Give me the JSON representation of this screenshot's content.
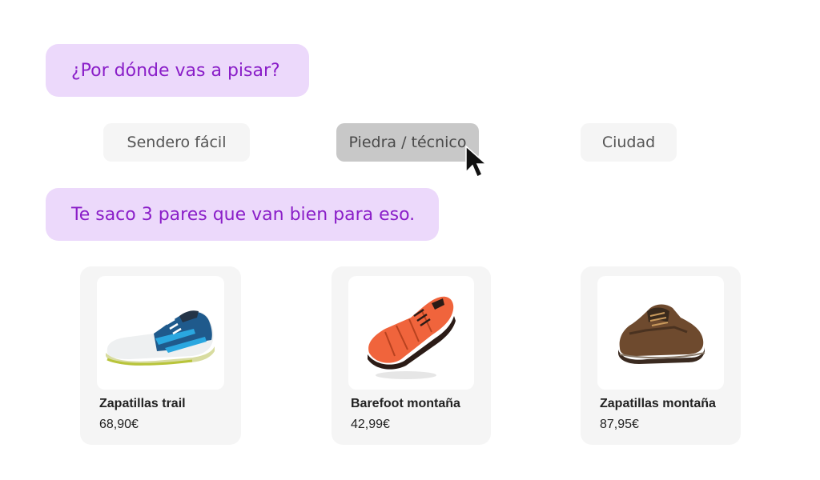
{
  "chat": {
    "question": "¿Por dónde vas a pisar?",
    "answer": "Te saco 3 pares que van bien para eso."
  },
  "options": [
    {
      "label": "Sendero fácil",
      "selected": false
    },
    {
      "label": "Piedra / técnico",
      "selected": true
    },
    {
      "label": "Ciudad",
      "selected": false
    }
  ],
  "products": [
    {
      "name": "Zapatillas trail",
      "price": "68,90€",
      "image": "trail-running-shoe-icon"
    },
    {
      "name": "Barefoot montaña",
      "price": "42,99€",
      "image": "barefoot-shoe-icon"
    },
    {
      "name": "Zapatillas montaña",
      "price": "87,95€",
      "image": "hiking-shoe-icon"
    }
  ],
  "colors": {
    "bubble_bg": "#ecd9fb",
    "bubble_text": "#8a1ec8",
    "chip_bg": "#f5f5f5",
    "chip_selected_bg": "#c8c8c8",
    "card_bg": "#f5f5f5"
  }
}
